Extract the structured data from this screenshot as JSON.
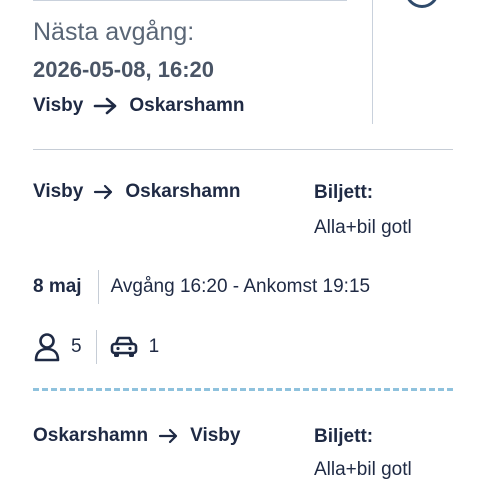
{
  "next_departure": {
    "label": "Nästa avgång:",
    "datetime": "2026-05-08, 16:20",
    "route": {
      "from": "Visby",
      "to": "Oskarshamn"
    }
  },
  "trips": [
    {
      "route": {
        "from": "Visby",
        "to": "Oskarshamn"
      },
      "ticket_label": "Biljett:",
      "ticket_value": "Alla+bil gotl",
      "date": "8 maj",
      "time": "Avgång 16:20 - Ankomst 19:15",
      "passengers": "5",
      "vehicles": "1"
    },
    {
      "route": {
        "from": "Oskarshamn",
        "to": "Visby"
      },
      "ticket_label": "Biljett:",
      "ticket_value": "Alla+bil gotl"
    }
  ],
  "colors": {
    "text_dark": "#1f2a44",
    "text_muted": "#5a6676",
    "divider": "#c6cdd6",
    "dashed_divider": "#8fc2dd"
  },
  "icons": [
    "arrow-right-icon",
    "person-icon",
    "car-icon"
  ]
}
